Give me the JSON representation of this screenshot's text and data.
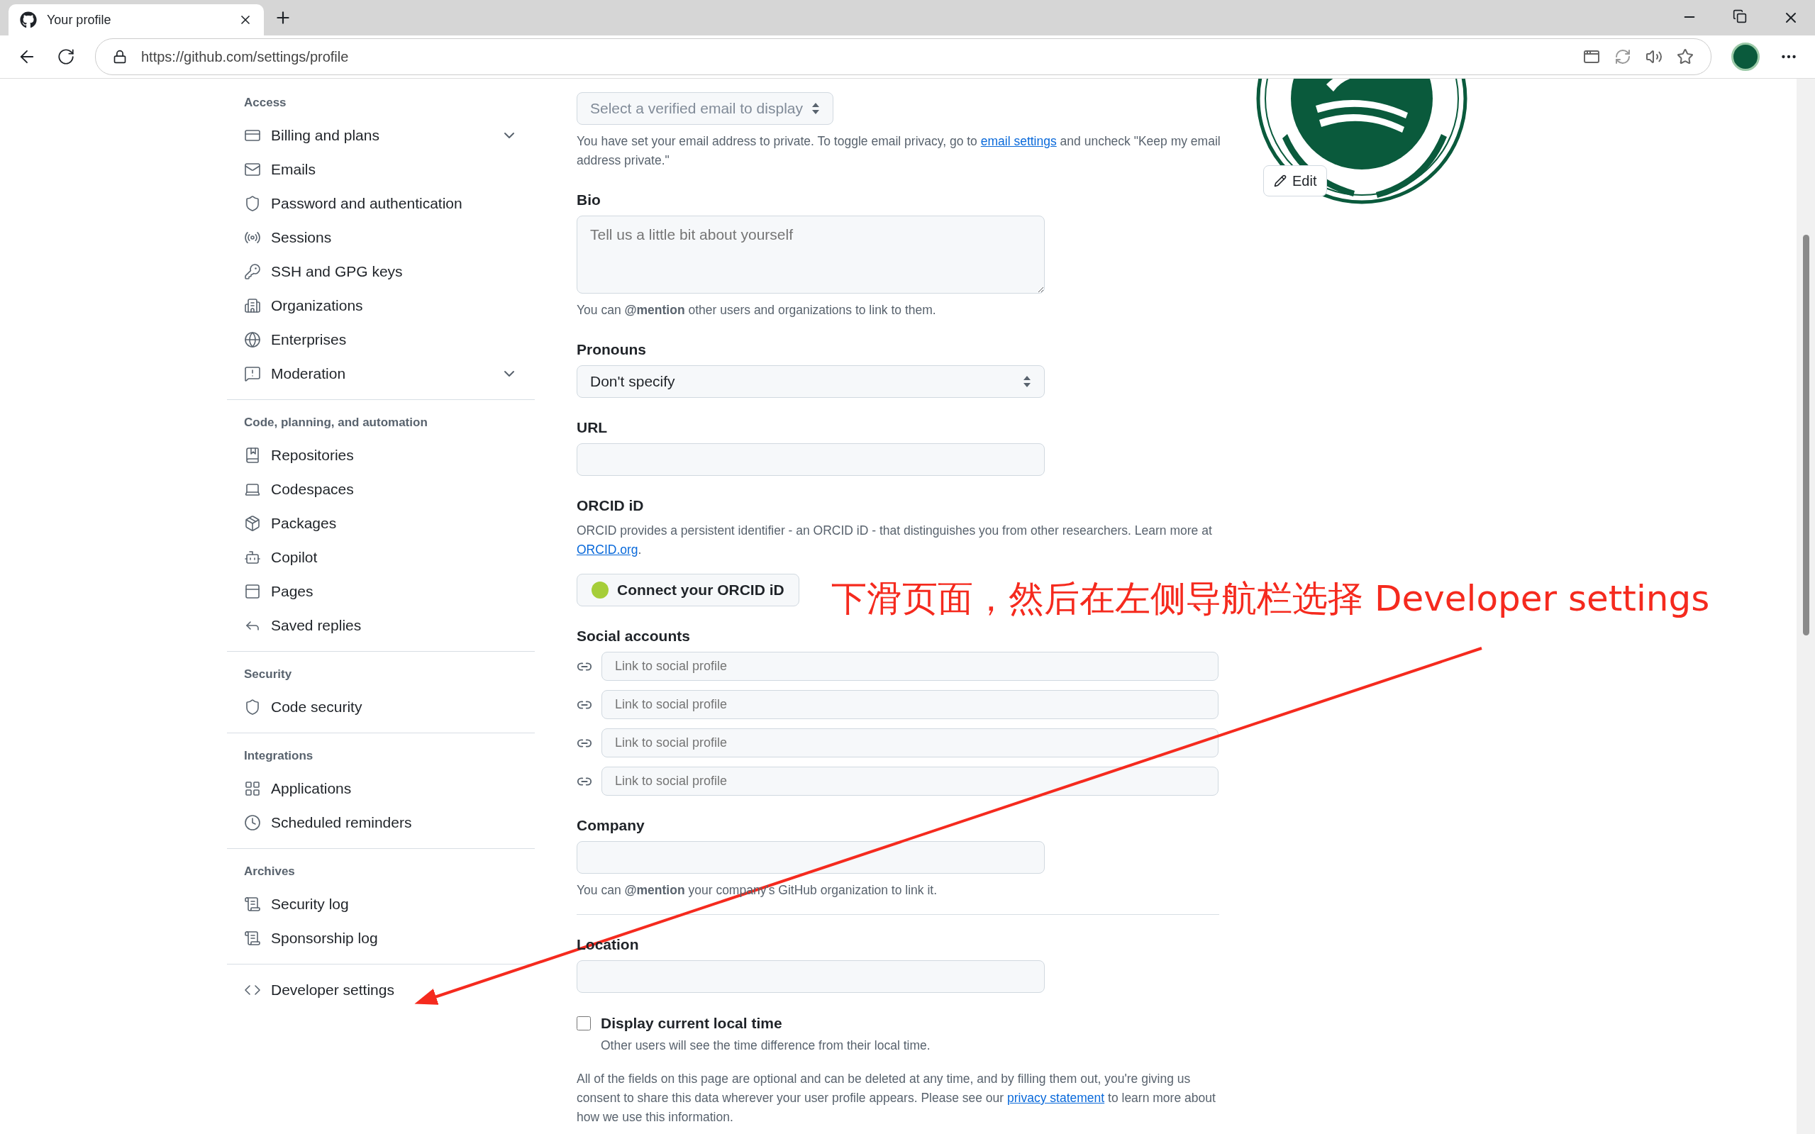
{
  "browser": {
    "tab": {
      "title": "Your profile",
      "selected": true
    },
    "url": "https://github.com/settings/profile"
  },
  "sidebar": {
    "sections": [
      {
        "heading": "Access",
        "items": [
          {
            "label": "Billing and plans",
            "kind": "collapsible",
            "expanded": false
          },
          {
            "label": "Emails",
            "kind": "link"
          },
          {
            "label": "Password and authentication",
            "kind": "link"
          },
          {
            "label": "Sessions",
            "kind": "link"
          },
          {
            "label": "SSH and GPG keys",
            "kind": "link"
          },
          {
            "label": "Organizations",
            "kind": "link"
          },
          {
            "label": "Enterprises",
            "kind": "link"
          },
          {
            "label": "Moderation",
            "kind": "collapsible",
            "expanded": false
          }
        ]
      },
      {
        "heading": "Code, planning, and automation",
        "items": [
          {
            "label": "Repositories",
            "kind": "link"
          },
          {
            "label": "Codespaces",
            "kind": "link"
          },
          {
            "label": "Packages",
            "kind": "link"
          },
          {
            "label": "Copilot",
            "kind": "link"
          },
          {
            "label": "Pages",
            "kind": "link"
          },
          {
            "label": "Saved replies",
            "kind": "link"
          }
        ]
      },
      {
        "heading": "Security",
        "items": [
          {
            "label": "Code security",
            "kind": "link"
          }
        ]
      },
      {
        "heading": "Integrations",
        "items": [
          {
            "label": "Applications",
            "kind": "link"
          },
          {
            "label": "Scheduled reminders",
            "kind": "link"
          }
        ]
      },
      {
        "heading": "Archives",
        "items": [
          {
            "label": "Security log",
            "kind": "link"
          },
          {
            "label": "Sponsorship log",
            "kind": "link"
          }
        ]
      },
      {
        "items": [
          {
            "label": "Developer settings",
            "kind": "link"
          }
        ]
      }
    ]
  },
  "profile": {
    "public_email": {
      "value": "Select a verified email to display",
      "disabled": true,
      "help_before": "You have set your email address to private. To toggle email privacy, go to",
      "help_link": "email settings",
      "help_after": "and uncheck \"Keep my email address private.\""
    },
    "bio": {
      "label": "Bio",
      "placeholder": "Tell us a little bit about yourself",
      "help": "You can **@mention** other users and organizations to link to them."
    },
    "pronouns": {
      "label": "Pronouns",
      "value": "Don't specify"
    },
    "url": {
      "label": "URL"
    },
    "orcid": {
      "label": "ORCID iD",
      "text": "ORCID provides a persistent identifier - an ORCID iD - that distinguishes you from other researchers. Learn more at",
      "link": "ORCID.org",
      "after": ".",
      "button": "Connect your ORCID iD"
    },
    "social": {
      "label": "Social accounts",
      "links": [
        {
          "placeholder": "Link to social profile"
        },
        {
          "placeholder": "Link to social profile"
        },
        {
          "placeholder": "Link to social profile"
        },
        {
          "placeholder": "Link to social profile"
        }
      ]
    },
    "company": {
      "label": "Company",
      "help": "You can **@mention** your company's GitHub organization to link it."
    },
    "location": {
      "label": "Location"
    },
    "local_time": {
      "label": "Display current local time",
      "checked": false,
      "help": "Other users will see the time difference from their local time."
    },
    "footer": {
      "before": "All of the fields on this page are optional and can be deleted at any time, and by filling them out, you're giving us consent to share this data wherever your user profile appears. Please see our",
      "link": "privacy statement",
      "after": "to learn more about how we use this information."
    },
    "avatar": {
      "kind": "picture",
      "edit": "Edit"
    }
  },
  "annotation": {
    "text": "下滑页面，然后在左侧导航栏选择 Developer settings"
  }
}
